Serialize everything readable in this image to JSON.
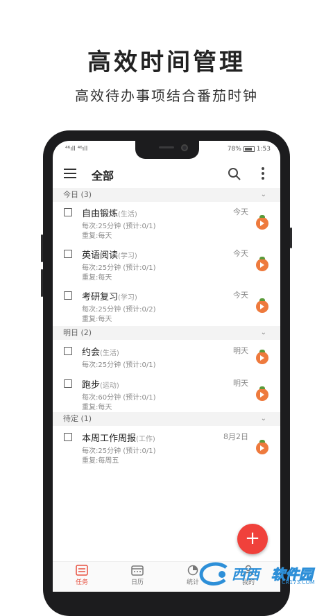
{
  "promo": {
    "headline": "高效时间管理",
    "subline": "高效待办事项结合番茄时钟"
  },
  "statusbar": {
    "signal": "⁴⁶ıll ⁴⁶ıll",
    "battery": "78%",
    "time": "1:53"
  },
  "appbar": {
    "title": "全部",
    "menu_icon": "hamburger-menu-icon",
    "search_icon": "search-icon",
    "more_icon": "more-vertical-icon"
  },
  "groups": [
    {
      "header": "今日 (3)",
      "tasks": [
        {
          "title": "自由锻炼",
          "category": "(生活)",
          "meta1": "每次:25分钟  (预计:0/1)",
          "meta2": "重复:每天",
          "date": "今天"
        },
        {
          "title": "英语阅读",
          "category": "(学习)",
          "meta1": "每次:25分钟  (预计:0/1)",
          "meta2": "重复:每天",
          "date": "今天"
        },
        {
          "title": "考研复习",
          "category": "(学习)",
          "meta1": "每次:25分钟  (预计:0/2)",
          "meta2": "重复:每天",
          "date": "今天"
        }
      ]
    },
    {
      "header": "明日 (2)",
      "tasks": [
        {
          "title": "约会",
          "category": "(生活)",
          "meta1": "每次:25分钟  (预计:0/1)",
          "meta2": "",
          "date": "明天"
        },
        {
          "title": "跑步",
          "category": "(运动)",
          "meta1": "每次:60分钟  (预计:0/1)",
          "meta2": "重复:每天",
          "date": "明天"
        }
      ]
    },
    {
      "header": "待定 (1)",
      "tasks": [
        {
          "title": "本周工作周报",
          "category": "(工作)",
          "meta1": "每次:25分钟  (预计:0/1)",
          "meta2": "重复:每周五",
          "date": "8月2日"
        }
      ]
    }
  ],
  "fab": {
    "label": "+"
  },
  "bottom_nav": [
    {
      "label": "任务",
      "icon": "task-list-icon",
      "active": true
    },
    {
      "label": "日历",
      "icon": "calendar-icon",
      "active": false
    },
    {
      "label": "统计",
      "icon": "stats-icon",
      "active": false
    },
    {
      "label": "我的",
      "icon": "profile-icon",
      "active": false
    }
  ],
  "colors": {
    "accent": "#e7503f",
    "fab": "#f0413b",
    "tomato": "#ee7a3d"
  },
  "watermark": {
    "text1": "西西",
    "text2": "软件园",
    "url": "CR173.COM"
  }
}
